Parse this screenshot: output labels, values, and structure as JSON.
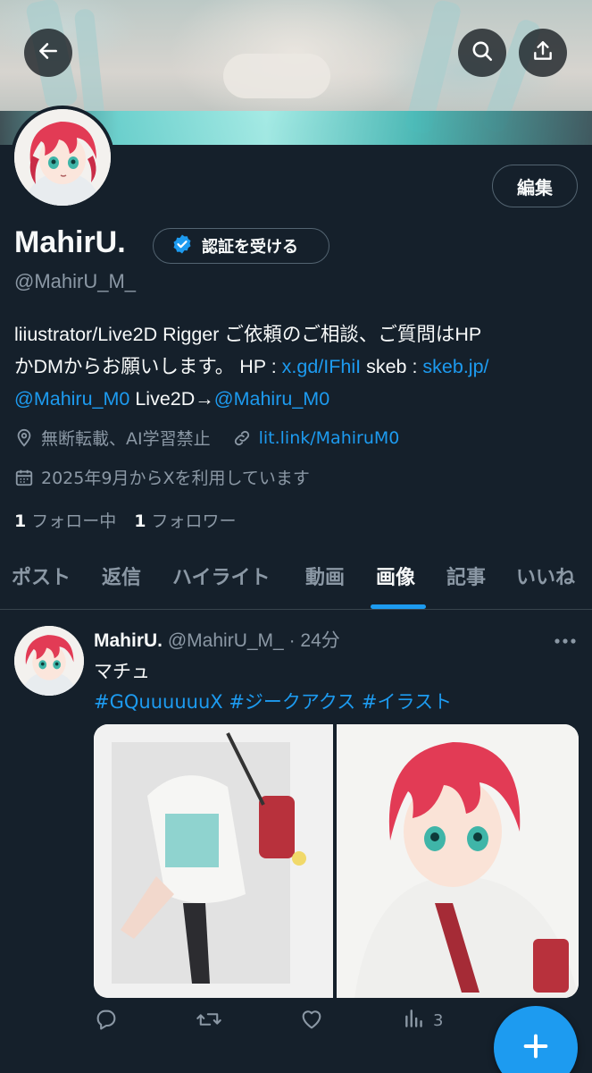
{
  "profile": {
    "name": "MahirU.",
    "handle": "@MahirU_M_",
    "edit_label": "編集",
    "verify_label": "認証を受ける",
    "bio": {
      "line1": "liiustrator/Live2D Rigger ご依頼のご相談、ご質問はHP",
      "line2_prefix": "かDMからお願いします。 HP : ",
      "hp_link": "x.gd/IFhiI",
      "skeb_label": " skeb : ",
      "skeb_link": "skeb.jp/",
      "line3_link1": "@Mahiru_M0",
      "line3_mid": " Live2D→",
      "line3_link2": "@Mahiru_M0"
    },
    "location": "無断転載、AI学習禁止",
    "website": "lit.link/MahiruM0",
    "joined": "2025年9月からXを利用しています",
    "following_count": "1",
    "following_label": "フォロー中",
    "followers_count": "1",
    "followers_label": "フォロワー"
  },
  "tabs": [
    {
      "label": "ポスト",
      "active": false
    },
    {
      "label": "返信",
      "active": false
    },
    {
      "label": "ハイライト",
      "active": false
    },
    {
      "label": "動画",
      "active": false
    },
    {
      "label": "画像",
      "active": true
    },
    {
      "label": "記事",
      "active": false
    },
    {
      "label": "いいね",
      "active": false
    }
  ],
  "post": {
    "author_name": "MahirU.",
    "author_handle": "@MahirU_M_",
    "separator": "·",
    "time": "24分",
    "text": "マチュ",
    "hashtags": "#GQuuuuuuX #ジークアクス #イラスト",
    "views": "3"
  },
  "icons": {
    "back": "arrow-left-icon",
    "search": "search-icon",
    "share": "share-icon",
    "verified": "verified-badge-icon",
    "location": "location-pin-icon",
    "link": "link-icon",
    "calendar": "calendar-icon",
    "reply": "reply-icon",
    "repost": "repost-icon",
    "like": "heart-icon",
    "views": "views-icon",
    "more": "more-dots-icon",
    "compose": "plus-icon"
  },
  "colors": {
    "background": "#15202b",
    "accent": "#1d9bf0",
    "muted": "#8b98a5",
    "text": "#f7f9f9"
  }
}
